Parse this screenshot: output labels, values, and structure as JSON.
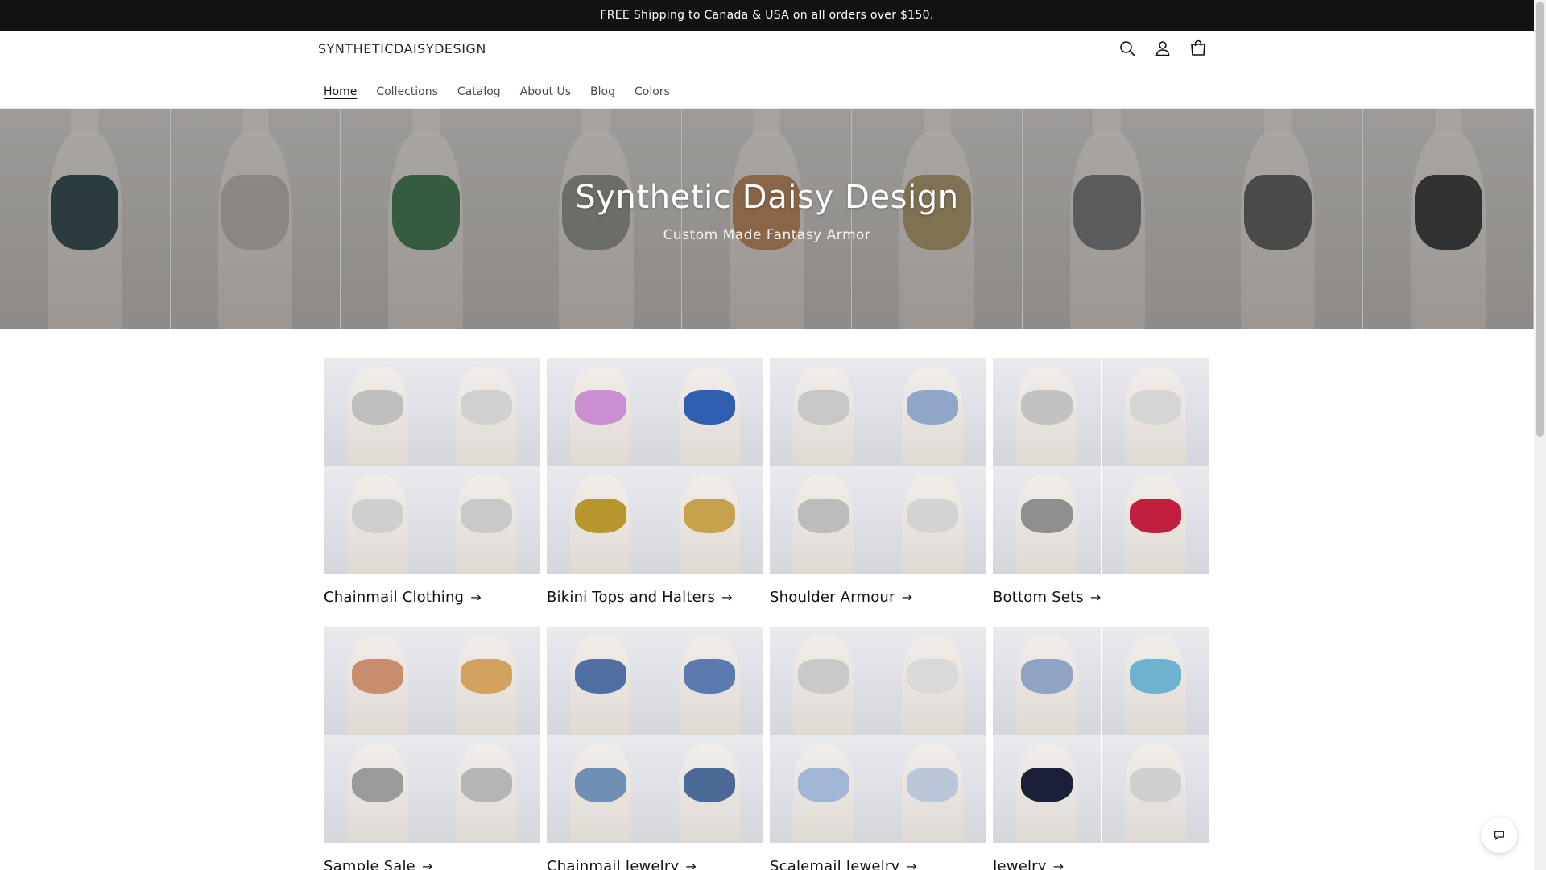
{
  "announcement": {
    "text": "FREE Shipping to Canada & USA on all orders over $150."
  },
  "header": {
    "logo": "SYNTHETICDAISYDESIGN",
    "icons": [
      "search-icon",
      "account-icon",
      "cart-icon"
    ]
  },
  "nav": {
    "items": [
      {
        "label": "Home",
        "active": true
      },
      {
        "label": "Collections"
      },
      {
        "label": "Catalog"
      },
      {
        "label": "About Us"
      },
      {
        "label": "Blog"
      },
      {
        "label": "Colors"
      }
    ]
  },
  "hero": {
    "title": "Synthetic Daisy Design",
    "subtitle": "Custom Made Fantasy Armor",
    "tile_colors": [
      "#1e3b3f",
      "#b9b4b0",
      "#2f6f44",
      "#8b8b83",
      "#b97f4f",
      "#a89462",
      "#6e6e6e",
      "#525252",
      "#2a2a2a"
    ]
  },
  "collections": [
    {
      "title": "Chainmail Clothing",
      "colors": [
        "#bfbfbf",
        "#d0d0d0",
        "#cfcfcf",
        "#c9c9c9"
      ]
    },
    {
      "title": "Bikini Tops and Halters",
      "colors": [
        "#c98fd0",
        "#2e5fb0",
        "#b8962e",
        "#c6a24a"
      ]
    },
    {
      "title": "Shoulder Armour",
      "colors": [
        "#c7c7c7",
        "#8fa6c9",
        "#bcbcbc",
        "#d3d3d3"
      ]
    },
    {
      "title": "Bottom Sets",
      "colors": [
        "#c2c2c2",
        "#d5d5d5",
        "#8f8f8f",
        "#c21f3f"
      ]
    },
    {
      "title": "Sample Sale",
      "colors": [
        "#c88d6f",
        "#d3a25e",
        "#9a9a9a",
        "#b5b5b5"
      ]
    },
    {
      "title": "Chainmail Jewelry",
      "colors": [
        "#4f6fa0",
        "#5a7ab0",
        "#6f8fb5",
        "#4a6a95"
      ]
    },
    {
      "title": "Scalemail Jewelry",
      "colors": [
        "#c9c9c9",
        "#d9d9d9",
        "#9fb6d6",
        "#b8c6d8"
      ]
    },
    {
      "title": "Jewelry",
      "colors": [
        "#8fa3c4",
        "#6fb2cf",
        "#1a1f3a",
        "#cfcfcf"
      ]
    }
  ],
  "arrow": "→",
  "colors": {
    "announcement_bg": "#121212",
    "text": "#121212"
  }
}
